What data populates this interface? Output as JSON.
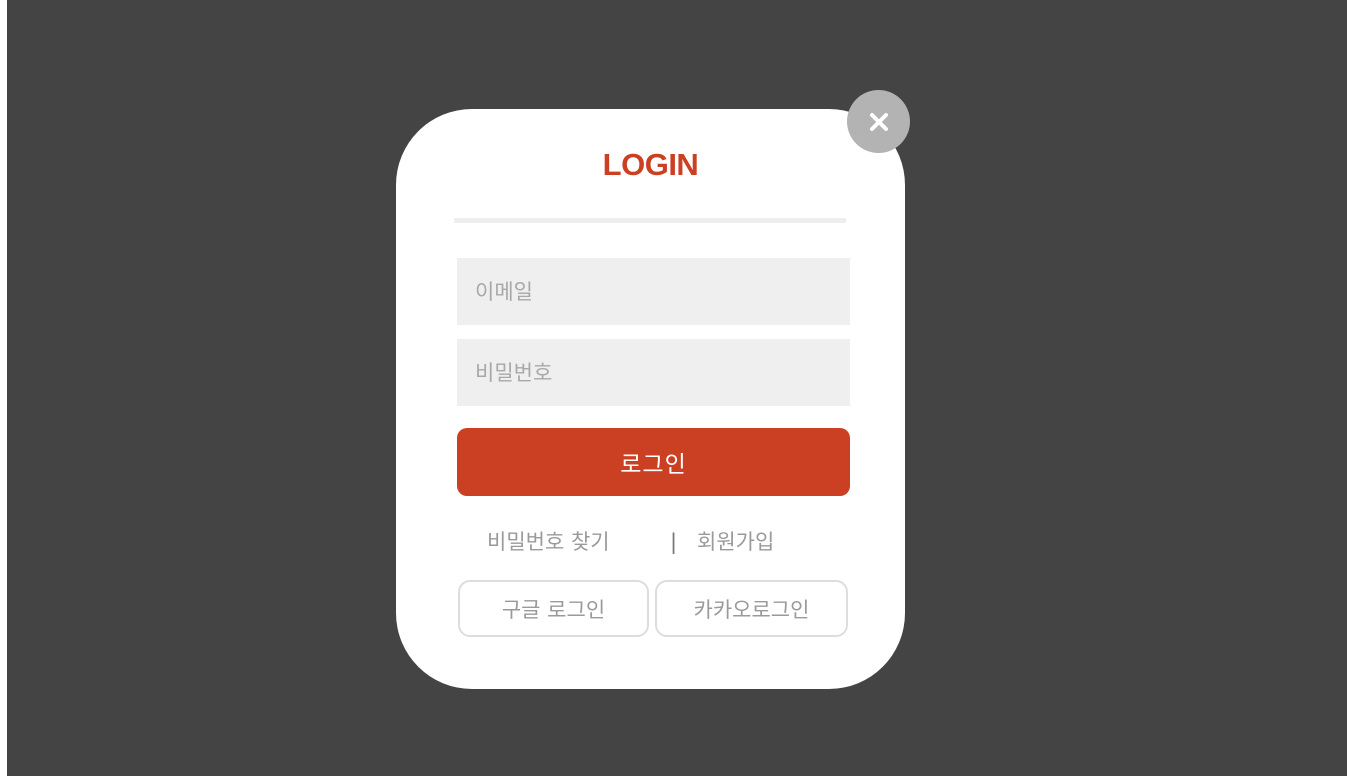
{
  "modal": {
    "title": "LOGIN",
    "close_icon": "close-icon",
    "email": {
      "placeholder": "이메일",
      "value": ""
    },
    "password": {
      "placeholder": "비밀번호",
      "value": ""
    },
    "login_label": "로그인",
    "links": {
      "find_password": "비밀번호 찾기",
      "separator": "|",
      "signup": "회원가입"
    },
    "social": {
      "google_label": "구글 로그인",
      "kakao_label": "카카오로그인"
    }
  },
  "colors": {
    "overlay": "#444444",
    "accent": "#cb4023",
    "field_bg": "#efefef",
    "close_bg": "#b3b3b3"
  }
}
